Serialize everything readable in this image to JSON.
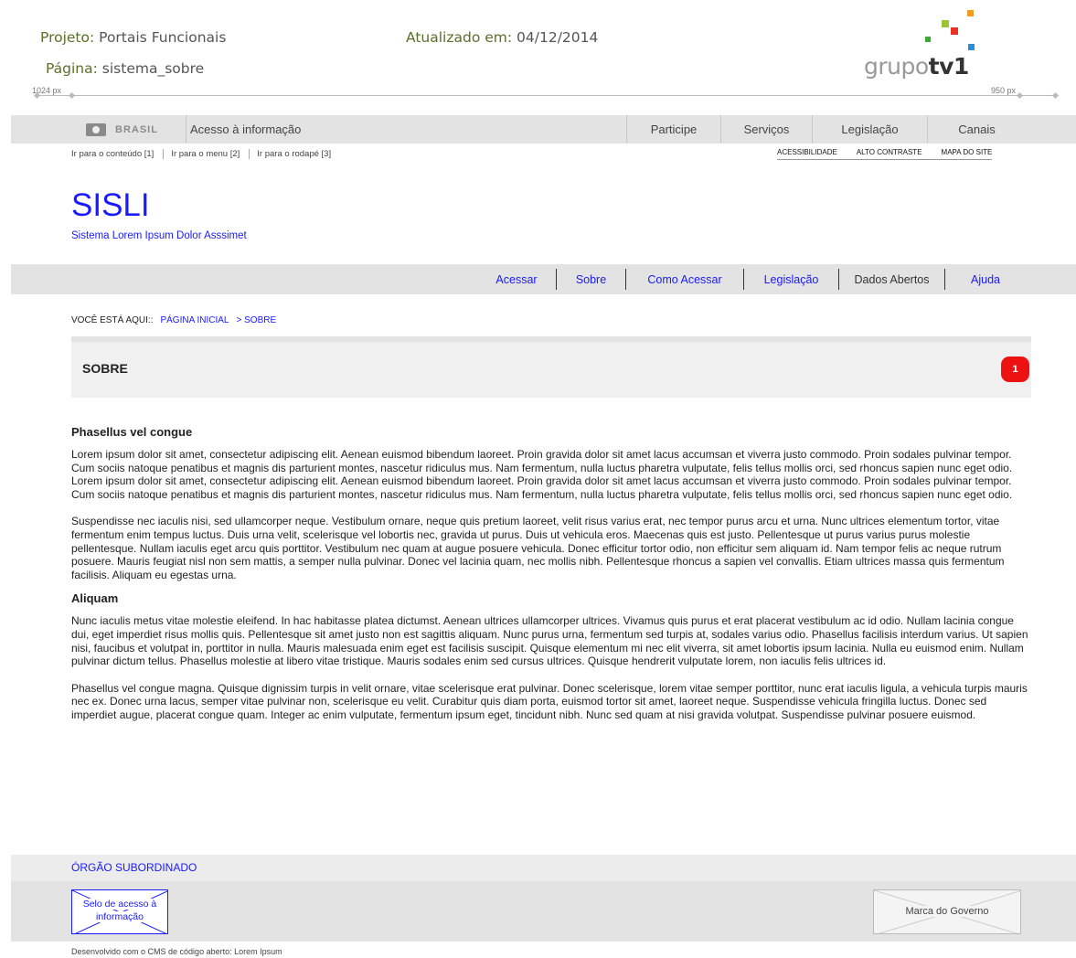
{
  "wireframe": {
    "project_key": "Projeto:",
    "project_value": "Portais Funcionais",
    "page_key": "Página:",
    "page_value": "sistema_sobre",
    "updated_key": "Atualizado em:",
    "updated_value": "04/12/2014",
    "ruler_left": "1024 px",
    "ruler_right": "950 px",
    "logo_light": "grupo",
    "logo_bold": "tv1"
  },
  "gov_bar": {
    "brasil": "BRASIL",
    "acesso": "Acesso à informação",
    "links": [
      "Participe",
      "Serviços",
      "Legislação",
      "Canais"
    ]
  },
  "skip_links": [
    "Ir para o conteúdo [1]",
    "Ir para o menu [2]",
    "Ir para o rodapé [3]"
  ],
  "access_links": [
    "ACESSIBILIDADE",
    "ALTO CONTRASTE",
    "MAPA DO SITE"
  ],
  "site": {
    "title": "SISLI",
    "subtitle": "Sistema Lorem Ipsum Dolor Asssimet"
  },
  "menu": [
    "Acessar",
    "Sobre",
    "Como Acessar",
    "Legislação",
    "Dados Abertos",
    "Ajuda"
  ],
  "breadcrumb": {
    "label": "VOCÊ ESTÁ AQUI::",
    "home": "PÁGINA INICIAL",
    "current": "> SOBRE"
  },
  "section": {
    "title": "SOBRE",
    "badge": "1"
  },
  "content": {
    "h1": "Phasellus vel congue",
    "p1": "Lorem ipsum dolor sit amet, consectetur adipiscing elit. Aenean euismod bibendum laoreet. Proin gravida dolor sit amet lacus accumsan et viverra justo commodo. Proin sodales pulvinar tempor. Cum sociis natoque penatibus et magnis dis parturient montes, nascetur ridiculus mus. Nam fermentum, nulla luctus pharetra vulputate, felis tellus mollis orci, sed rhoncus sapien nunc eget odio. Lorem ipsum dolor sit amet, consectetur adipiscing elit. Aenean euismod bibendum laoreet. Proin gravida dolor sit amet lacus accumsan et viverra justo commodo. Proin sodales pulvinar tempor. Cum sociis natoque penatibus et magnis dis parturient montes, nascetur ridiculus mus. Nam fermentum, nulla luctus pharetra vulputate, felis tellus mollis orci, sed rhoncus sapien nunc eget odio.",
    "p2": "Suspendisse nec iaculis nisi, sed ullamcorper neque. Vestibulum ornare, neque quis pretium laoreet, velit risus varius erat, nec tempor purus arcu et urna. Nunc ultrices elementum tortor, vitae fermentum enim tempus luctus. Duis urna velit, scelerisque vel lobortis nec, gravida ut purus. Duis ut vehicula eros. Maecenas quis est justo. Pellentesque ut purus varius purus molestie pellentesque. Nullam iaculis eget arcu quis porttitor. Vestibulum nec quam at augue posuere vehicula. Donec efficitur tortor odio, non efficitur sem aliquam id. Nam tempor felis ac neque rutrum posuere. Mauris feugiat nisl non sem mattis, a semper nulla pulvinar. Donec vel lacinia quam, nec mollis nibh. Pellentesque rhoncus a sapien vel convallis. Etiam ultrices massa quis fermentum facilisis. Aliquam eu egestas urna.",
    "h2": "Aliquam",
    "p3": "Nunc iaculis metus vitae molestie eleifend. In hac habitasse platea dictumst. Aenean ultrices ullamcorper ultrices. Vivamus quis purus et erat placerat vestibulum ac id odio. Nullam lacinia congue dui, eget imperdiet risus mollis quis. Pellentesque sit amet justo non est sagittis aliquam. Nunc purus urna, fermentum sed turpis at, sodales varius odio. Phasellus facilisis interdum varius. Ut sapien nisi, faucibus et volutpat in, porttitor in nulla. Mauris malesuada enim eget est facilisis suscipit. Quisque elementum mi nec elit viverra, sit amet lobortis ipsum lacinia. Nulla eu euismod enim. Nullam pulvinar dictum tellus. Phasellus molestie at libero vitae tristique. Mauris sodales enim sed cursus ultrices. Quisque hendrerit vulputate lorem, non iaculis felis ultrices id.",
    "p4": "Phasellus vel congue magna. Quisque dignissim turpis in velit ornare, vitae scelerisque erat pulvinar. Donec scelerisque, lorem vitae semper porttitor, nunc erat iaculis ligula, a vehicula turpis mauris nec ex. Donec urna lacus, semper vitae pulvinar non, scelerisque eu velit. Curabitur quis diam porta, euismod tortor sit amet, laoreet neque. Suspendisse vehicula fringilla luctus. Donec sed imperdiet augue, placerat congue quam. Integer ac enim vulputate, fermentum ipsum eget, tincidunt nibh. Nunc sed quam at nisi gravida volutpat. Suspendisse pulvinar posuere euismod."
  },
  "footer": {
    "org": "ÓRGÃO SUBORDINADO",
    "selo": "Selo de acesso à informação",
    "marca": "Marca do Governo",
    "dev": "Desenvolvido com o CMS de código aberto: Lorem Ipsum"
  },
  "colors": {
    "link": "#1a1aff",
    "bar": "#e3e3e3",
    "badge": "#ee1111",
    "wireframe_key": "#5a6f2a"
  }
}
